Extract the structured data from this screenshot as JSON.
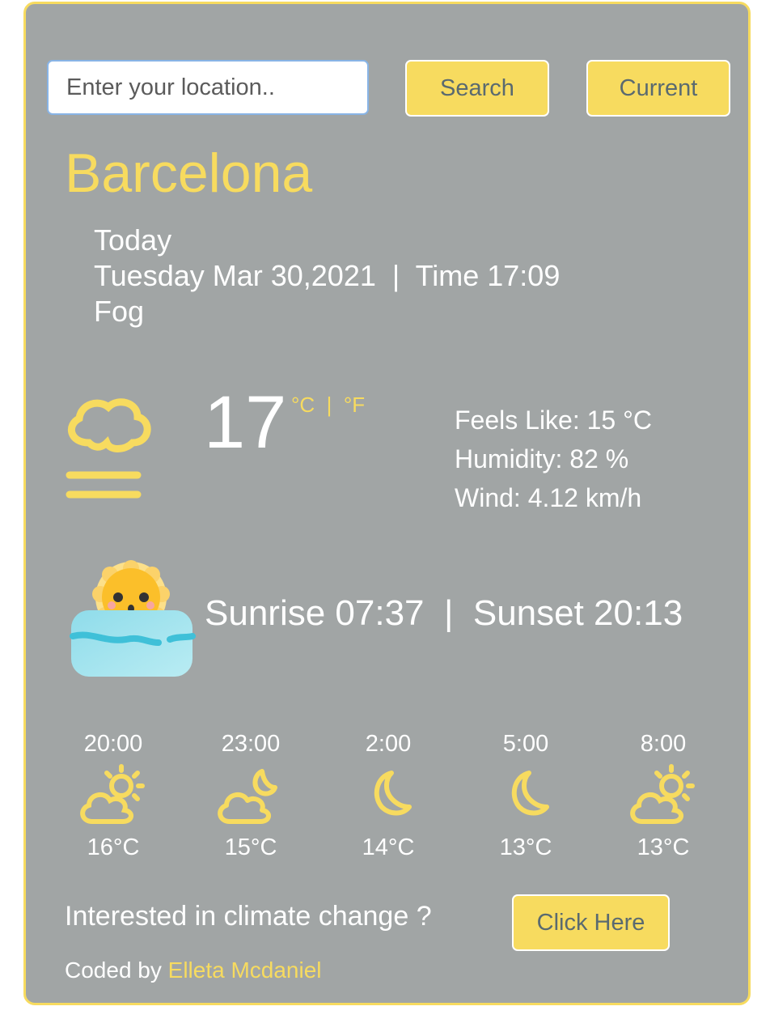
{
  "search": {
    "placeholder": "Enter your location..",
    "search_label": "Search",
    "current_label": "Current"
  },
  "city": "Barcelona",
  "today": {
    "label": "Today",
    "date_time": "Tuesday Mar 30,2021  |  Time 17:09",
    "description": "Fog"
  },
  "current": {
    "temperature": "17",
    "units": "°C  |  °F",
    "feels_like": "Feels Like: 15 °C",
    "humidity": "Humidity: 82 %",
    "wind": "Wind: 4.12 km/h",
    "icon": "fog-icon"
  },
  "sun": {
    "text": "Sunrise 07:37  |  Sunset 20:13",
    "icon": "sunrise-illustration"
  },
  "forecast": [
    {
      "time": "20:00",
      "temp": "16°C",
      "icon": "partly-cloudy-day-icon"
    },
    {
      "time": "23:00",
      "temp": "15°C",
      "icon": "partly-cloudy-night-icon"
    },
    {
      "time": "2:00",
      "temp": "14°C",
      "icon": "moon-icon"
    },
    {
      "time": "5:00",
      "temp": "13°C",
      "icon": "moon-icon"
    },
    {
      "time": "8:00",
      "temp": "13°C",
      "icon": "partly-cloudy-day-icon"
    }
  ],
  "footer": {
    "climate_text": "Interested in climate change ?",
    "click_label": "Click Here",
    "coded_by": "Coded by ",
    "author": "Elleta Mcdaniel"
  },
  "colors": {
    "accent": "#f7db5f",
    "card_background": "#a1a5a5",
    "text": "#ffffff"
  }
}
